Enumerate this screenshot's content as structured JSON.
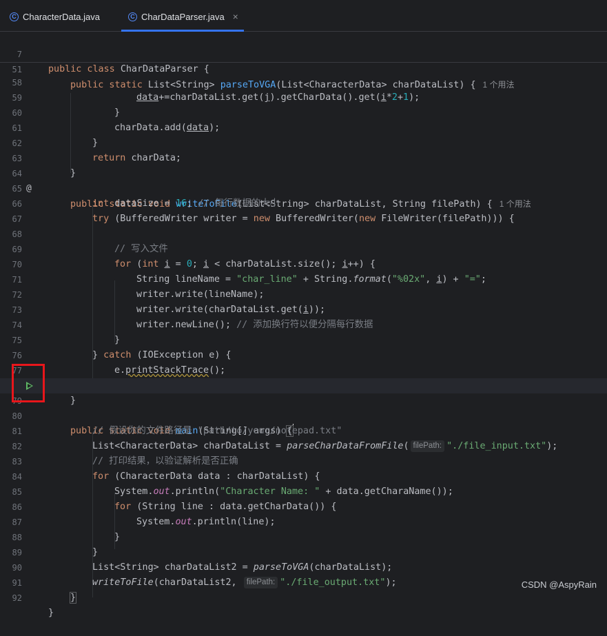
{
  "tabs": [
    {
      "label": "CharacterData.java",
      "icon": "class-c-icon",
      "active": false
    },
    {
      "label": "CharDataParser.java",
      "icon": "class-c-icon",
      "active": true,
      "close": "×"
    }
  ],
  "lines": {
    "l7": {
      "n": "7",
      "t1": "public class ",
      "t2": "CharDataParser {"
    },
    "l51": {
      "n": "51",
      "t1": "public static ",
      "t2": "List<String> ",
      "t3": "parseToVGA",
      "t4": "(List<CharacterData> charDataList) {",
      "usage": "1 个用法"
    },
    "l58": {
      "n": "58",
      "a": "data",
      "b": "+=charDataList.get(",
      "c": "j",
      "d": ").getCharData().get(",
      "e": "i",
      "f": "*",
      "g": "2",
      "h": "+",
      "i": "1",
      "j": ");"
    },
    "l59": {
      "n": "59",
      "t": "}"
    },
    "l60": {
      "n": "60",
      "a": "charData.add(",
      "b": "data",
      "c": ");"
    },
    "l61": {
      "n": "61",
      "t": "}"
    },
    "l62": {
      "n": "62",
      "a": "return ",
      "b": "charData;"
    },
    "l63": {
      "n": "63",
      "t": "}"
    },
    "l64": {
      "n": "64",
      "a": "public static void ",
      "b": "writeToFile",
      "c": "(List<String> charDataList, String filePath) {",
      "usage": "1 个用法"
    },
    "l65": {
      "n": "65",
      "a": "int ",
      "b": "dataSize = ",
      "c": "16",
      "d": "; ",
      "e": "// 每行数据的大小"
    },
    "l66": {
      "n": "66",
      "a": "try ",
      "b": "(BufferedWriter writer = ",
      "c": "new ",
      "d": "BufferedWriter(",
      "e": "new ",
      "f": "FileWriter(filePath))) {"
    },
    "l67": {
      "n": "67"
    },
    "l68": {
      "n": "68",
      "t": "// 写入文件"
    },
    "l69": {
      "n": "69",
      "a": "for ",
      "b": "(",
      "c": "int ",
      "d": "i",
      "e": " = ",
      "f": "0",
      "g": "; ",
      "h": "i",
      "i": " < charDataList.size(); ",
      "j": "i",
      "k": "++) {"
    },
    "l70": {
      "n": "70",
      "a": "String lineName = ",
      "b": "\"char_line\"",
      "c": " + String.",
      "d": "format",
      "e": "(",
      "f": "\"%02x\"",
      "g": ", ",
      "h": "i",
      "i": ") + ",
      "j": "\"=\"",
      "k": ";"
    },
    "l71": {
      "n": "71",
      "t": "writer.write(lineName);"
    },
    "l72": {
      "n": "72",
      "a": "writer.write(charDataList.get(",
      "b": "i",
      "c": "));"
    },
    "l73": {
      "n": "73",
      "a": "writer.newLine(); ",
      "b": "// 添加换行符以便分隔每行数据"
    },
    "l74": {
      "n": "74",
      "t": "}"
    },
    "l75": {
      "n": "75",
      "a": "} ",
      "b": "catch ",
      "c": "(IOException e) {"
    },
    "l76": {
      "n": "76",
      "a": "e.",
      "b": "printStackTrace",
      "c": "();"
    },
    "l77": {
      "n": "77",
      "t": "}"
    },
    "l78": {
      "n": "78",
      "t": "}"
    },
    "l79": {
      "n": "79",
      "a": "public static void ",
      "b": "main",
      "c": "(String[] args) ",
      "d": "{"
    },
    "l80": {
      "n": "80",
      "t": "// 假设你的文件路径是 \"path/to/your/notepad.txt\""
    },
    "l81": {
      "n": "81",
      "a": "List<CharacterData> charDataList = ",
      "b": "parseCharDataFromFile",
      "c": "(",
      "hint": "filePath:",
      "d": "\"./file_input.txt\"",
      "e": ");"
    },
    "l82": {
      "n": "82",
      "t": "// 打印结果，以验证解析是否正确"
    },
    "l83": {
      "n": "83",
      "a": "for ",
      "b": "(CharacterData data : charDataList) {"
    },
    "l84": {
      "n": "84",
      "a": "System.",
      "b": "out",
      "c": ".println(",
      "d": "\"Character Name: \"",
      "e": " + data.getCharaName());"
    },
    "l85": {
      "n": "85",
      "a": "for ",
      "b": "(String line : data.getCharData()) {"
    },
    "l86": {
      "n": "86",
      "a": "System.",
      "b": "out",
      "c": ".println(line);"
    },
    "l87": {
      "n": "87",
      "t": "}"
    },
    "l88": {
      "n": "88",
      "t": "}"
    },
    "l89": {
      "n": "89",
      "a": "List<String> charDataList2 = ",
      "b": "parseToVGA",
      "c": "(charDataList);"
    },
    "l90": {
      "n": "90",
      "a": "writeToFile",
      "b": "(charDataList2, ",
      "hint": "filePath:",
      "c": "\"./file_output.txt\"",
      "d": ");"
    },
    "l91": {
      "n": "91",
      "t": "}"
    },
    "l92": {
      "n": "92",
      "t": "}"
    }
  },
  "watermark": "CSDN @AspyRain",
  "colors": {
    "keyword": "#cf8e6d",
    "function": "#56a8f5",
    "string": "#6aab73",
    "number": "#2aacb8",
    "comment": "#7a7e85",
    "run_icon": "#5fb865",
    "highlight_box": "#e8161b"
  }
}
